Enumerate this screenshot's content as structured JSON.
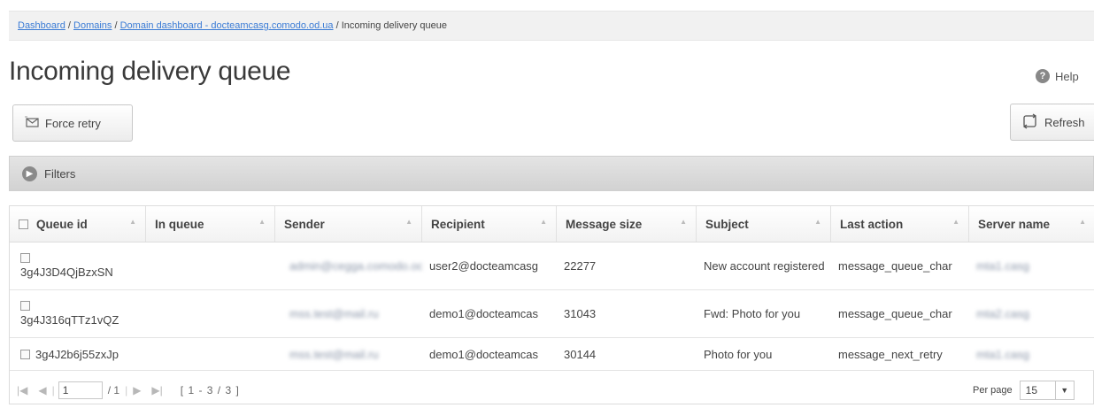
{
  "breadcrumb": {
    "items": [
      "Dashboard",
      "Domains",
      "Domain dashboard - docteamcasg.comodo.od.ua"
    ],
    "separator": "/",
    "current": "Incoming delivery queue"
  },
  "page_title": "Incoming delivery queue",
  "help_label": "Help",
  "toolbar": {
    "force_retry_label": "Force retry",
    "refresh_label": "Refresh"
  },
  "filters_label": "Filters",
  "table": {
    "columns": [
      "Queue id",
      "In queue",
      "Sender",
      "Recipient",
      "Message size",
      "Subject",
      "Last action",
      "Server name"
    ],
    "rows": [
      {
        "queue_id": "3g4J3D4QjBzxSN",
        "in_queue": "",
        "sender": "admin@cegga.comodo.od.ua",
        "recipient": "user2@docteamcasg",
        "message_size": "22277",
        "subject": "New account registered",
        "last_action": "message_queue_char",
        "server_name": "mta1.casg"
      },
      {
        "queue_id": "3g4J316qTTz1vQZ",
        "in_queue": "",
        "sender": "mss.test@mail.ru",
        "recipient": "demo1@docteamcas",
        "message_size": "31043",
        "subject": "Fwd: Photo for you",
        "last_action": "message_queue_char",
        "server_name": "mta2.casg"
      },
      {
        "queue_id": "3g4J2b6j55zxJp",
        "in_queue": "",
        "sender": "mss.test@mail.ru",
        "recipient": "demo1@docteamcas",
        "message_size": "30144",
        "subject": "Photo for you",
        "last_action": "message_next_retry",
        "server_name": "mta1.casg"
      }
    ]
  },
  "pager": {
    "page_value": "1",
    "total_pages": "/ 1",
    "range": "[ 1 - 3 / 3 ]",
    "per_page_label": "Per page",
    "per_page_value": "15"
  }
}
